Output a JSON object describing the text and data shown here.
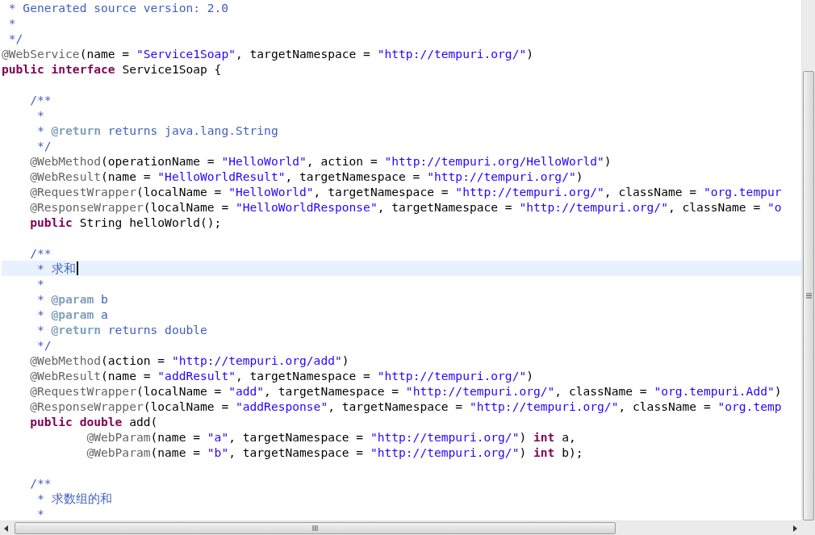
{
  "lines": [
    {
      "current": false,
      "segments": [
        {
          "kind": "comment",
          "text": " * Generated source version: 2.0"
        }
      ]
    },
    {
      "current": false,
      "segments": [
        {
          "kind": "comment",
          "text": " *"
        }
      ]
    },
    {
      "current": false,
      "segments": [
        {
          "kind": "comment",
          "text": " */"
        }
      ]
    },
    {
      "current": false,
      "segments": [
        {
          "kind": "annotation",
          "text": "@WebService"
        },
        {
          "kind": "plain",
          "text": "(name = "
        },
        {
          "kind": "string",
          "text": "\"Service1Soap\""
        },
        {
          "kind": "plain",
          "text": ", targetNamespace = "
        },
        {
          "kind": "string",
          "text": "\"http://tempuri.org/\""
        },
        {
          "kind": "plain",
          "text": ")"
        }
      ]
    },
    {
      "current": false,
      "segments": [
        {
          "kind": "keyword",
          "text": "public"
        },
        {
          "kind": "keyword",
          "text": " interface"
        },
        {
          "kind": "plain",
          "text": " Service1Soap {"
        }
      ]
    },
    {
      "current": false
    },
    {
      "current": false,
      "segments": [
        {
          "kind": "comment",
          "text": "    /**"
        }
      ]
    },
    {
      "current": false,
      "segments": [
        {
          "kind": "comment",
          "text": "     *"
        }
      ]
    },
    {
      "current": false,
      "segments": [
        {
          "kind": "comment",
          "text": "     * "
        },
        {
          "kind": "doctag",
          "text": "@return"
        },
        {
          "kind": "comment",
          "text": " returns java.lang.String"
        }
      ]
    },
    {
      "current": false,
      "segments": [
        {
          "kind": "comment",
          "text": "     */"
        }
      ]
    },
    {
      "current": false,
      "segments": [
        {
          "kind": "annotation",
          "text": "    @WebMethod"
        },
        {
          "kind": "plain",
          "text": "(operationName = "
        },
        {
          "kind": "string",
          "text": "\"HelloWorld\""
        },
        {
          "kind": "plain",
          "text": ", action = "
        },
        {
          "kind": "string",
          "text": "\"http://tempuri.org/HelloWorld\""
        },
        {
          "kind": "plain",
          "text": ")"
        }
      ]
    },
    {
      "current": false,
      "segments": [
        {
          "kind": "annotation",
          "text": "    @WebResult"
        },
        {
          "kind": "plain",
          "text": "(name = "
        },
        {
          "kind": "string",
          "text": "\"HelloWorldResult\""
        },
        {
          "kind": "plain",
          "text": ", targetNamespace = "
        },
        {
          "kind": "string",
          "text": "\"http://tempuri.org/\""
        },
        {
          "kind": "plain",
          "text": ")"
        }
      ]
    },
    {
      "current": false,
      "segments": [
        {
          "kind": "annotation",
          "text": "    @RequestWrapper"
        },
        {
          "kind": "plain",
          "text": "(localName = "
        },
        {
          "kind": "string",
          "text": "\"HelloWorld\""
        },
        {
          "kind": "plain",
          "text": ", targetNamespace = "
        },
        {
          "kind": "string",
          "text": "\"http://tempuri.org/\""
        },
        {
          "kind": "plain",
          "text": ", className = "
        },
        {
          "kind": "string",
          "text": "\"org.tempur"
        }
      ]
    },
    {
      "current": false,
      "segments": [
        {
          "kind": "annotation",
          "text": "    @ResponseWrapper"
        },
        {
          "kind": "plain",
          "text": "(localName = "
        },
        {
          "kind": "string",
          "text": "\"HelloWorldResponse\""
        },
        {
          "kind": "plain",
          "text": ", targetNamespace = "
        },
        {
          "kind": "string",
          "text": "\"http://tempuri.org/\""
        },
        {
          "kind": "plain",
          "text": ", className = "
        },
        {
          "kind": "string",
          "text": "\"o"
        }
      ]
    },
    {
      "current": false,
      "segments": [
        {
          "kind": "keyword",
          "text": "    public"
        },
        {
          "kind": "plain",
          "text": " String helloWorld();"
        }
      ]
    },
    {
      "current": false
    },
    {
      "current": false,
      "segments": [
        {
          "kind": "comment",
          "text": "    /**"
        }
      ]
    },
    {
      "current": true,
      "segments": [
        {
          "kind": "comment",
          "text": "     * 求和"
        }
      ]
    },
    {
      "current": false,
      "segments": [
        {
          "kind": "comment",
          "text": "     *"
        }
      ]
    },
    {
      "current": false,
      "segments": [
        {
          "kind": "comment",
          "text": "     * "
        },
        {
          "kind": "doctag",
          "text": "@param"
        },
        {
          "kind": "comment",
          "text": " b"
        }
      ]
    },
    {
      "current": false,
      "segments": [
        {
          "kind": "comment",
          "text": "     * "
        },
        {
          "kind": "doctag",
          "text": "@param"
        },
        {
          "kind": "comment",
          "text": " a"
        }
      ]
    },
    {
      "current": false,
      "segments": [
        {
          "kind": "comment",
          "text": "     * "
        },
        {
          "kind": "doctag",
          "text": "@return"
        },
        {
          "kind": "comment",
          "text": " returns double"
        }
      ]
    },
    {
      "current": false,
      "segments": [
        {
          "kind": "comment",
          "text": "     */"
        }
      ]
    },
    {
      "current": false,
      "segments": [
        {
          "kind": "annotation",
          "text": "    @WebMethod"
        },
        {
          "kind": "plain",
          "text": "(action = "
        },
        {
          "kind": "string",
          "text": "\"http://tempuri.org/add\""
        },
        {
          "kind": "plain",
          "text": ")"
        }
      ]
    },
    {
      "current": false,
      "segments": [
        {
          "kind": "annotation",
          "text": "    @WebResult"
        },
        {
          "kind": "plain",
          "text": "(name = "
        },
        {
          "kind": "string",
          "text": "\"addResult\""
        },
        {
          "kind": "plain",
          "text": ", targetNamespace = "
        },
        {
          "kind": "string",
          "text": "\"http://tempuri.org/\""
        },
        {
          "kind": "plain",
          "text": ")"
        }
      ]
    },
    {
      "current": false,
      "segments": [
        {
          "kind": "annotation",
          "text": "    @RequestWrapper"
        },
        {
          "kind": "plain",
          "text": "(localName = "
        },
        {
          "kind": "string",
          "text": "\"add\""
        },
        {
          "kind": "plain",
          "text": ", targetNamespace = "
        },
        {
          "kind": "string",
          "text": "\"http://tempuri.org/\""
        },
        {
          "kind": "plain",
          "text": ", className = "
        },
        {
          "kind": "string",
          "text": "\"org.tempuri.Add\""
        },
        {
          "kind": "plain",
          "text": ")"
        }
      ]
    },
    {
      "current": false,
      "segments": [
        {
          "kind": "annotation",
          "text": "    @ResponseWrapper"
        },
        {
          "kind": "plain",
          "text": "(localName = "
        },
        {
          "kind": "string",
          "text": "\"addResponse\""
        },
        {
          "kind": "plain",
          "text": ", targetNamespace = "
        },
        {
          "kind": "string",
          "text": "\"http://tempuri.org/\""
        },
        {
          "kind": "plain",
          "text": ", className = "
        },
        {
          "kind": "string",
          "text": "\"org.temp"
        }
      ]
    },
    {
      "current": false,
      "segments": [
        {
          "kind": "keyword",
          "text": "    public"
        },
        {
          "kind": "keyword",
          "text": " double"
        },
        {
          "kind": "plain",
          "text": " add("
        }
      ]
    },
    {
      "current": false,
      "segments": [
        {
          "kind": "annotation",
          "text": "            @WebParam"
        },
        {
          "kind": "plain",
          "text": "(name = "
        },
        {
          "kind": "string",
          "text": "\"a\""
        },
        {
          "kind": "plain",
          "text": ", targetNamespace = "
        },
        {
          "kind": "string",
          "text": "\"http://tempuri.org/\""
        },
        {
          "kind": "plain",
          "text": ") "
        },
        {
          "kind": "keyword",
          "text": "int"
        },
        {
          "kind": "plain",
          "text": " a,"
        }
      ]
    },
    {
      "current": false,
      "segments": [
        {
          "kind": "annotation",
          "text": "            @WebParam"
        },
        {
          "kind": "plain",
          "text": "(name = "
        },
        {
          "kind": "string",
          "text": "\"b\""
        },
        {
          "kind": "plain",
          "text": ", targetNamespace = "
        },
        {
          "kind": "string",
          "text": "\"http://tempuri.org/\""
        },
        {
          "kind": "plain",
          "text": ") "
        },
        {
          "kind": "keyword",
          "text": "int"
        },
        {
          "kind": "plain",
          "text": " b);"
        }
      ]
    },
    {
      "current": false
    },
    {
      "current": false,
      "segments": [
        {
          "kind": "comment",
          "text": "    /**"
        }
      ]
    },
    {
      "current": false,
      "segments": [
        {
          "kind": "comment",
          "text": "     * 求数组的和"
        }
      ]
    },
    {
      "current": false,
      "segments": [
        {
          "kind": "comment",
          "text": "     *"
        }
      ]
    }
  ]
}
